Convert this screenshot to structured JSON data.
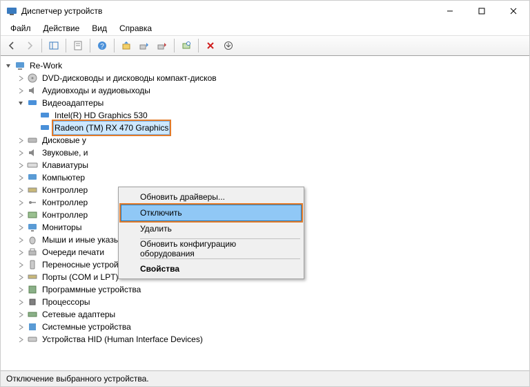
{
  "window": {
    "title": "Диспетчер устройств"
  },
  "menu": {
    "file": "Файл",
    "action": "Действие",
    "view": "Вид",
    "help": "Справка"
  },
  "tree": {
    "root": "Re-Work",
    "dvd": "DVD-дисководы и дисководы компакт-дисков",
    "audio": "Аудиовходы и аудиовыходы",
    "video": "Видеоадаптеры",
    "video_children": {
      "intel": "Intel(R) HD Graphics 530",
      "radeon": "Radeon (TM) RX 470 Graphics"
    },
    "disk": "Дисковые у",
    "sound": "Звуковые, и",
    "keyboard": "Клавиатуры",
    "computer": "Компьютер",
    "ctrl_ide": "Контроллер",
    "ctrl_usb": "Контроллер",
    "ctrl_stor": "Контроллер",
    "monitors": "Мониторы",
    "mice": "Мыши и иные указывающие устройства",
    "print_queues": "Очереди печати",
    "portable": "Переносные устройства",
    "ports": "Порты (COM и LPT)",
    "software": "Программные устройства",
    "processors": "Процессоры",
    "network": "Сетевые адаптеры",
    "system": "Системные устройства",
    "hid": "Устройства HID (Human Interface Devices)"
  },
  "context_menu": {
    "update": "Обновить драйверы...",
    "disable": "Отключить",
    "uninstall": "Удалить",
    "scan": "Обновить конфигурацию оборудования",
    "properties": "Свойства"
  },
  "status": "Отключение выбранного устройства."
}
